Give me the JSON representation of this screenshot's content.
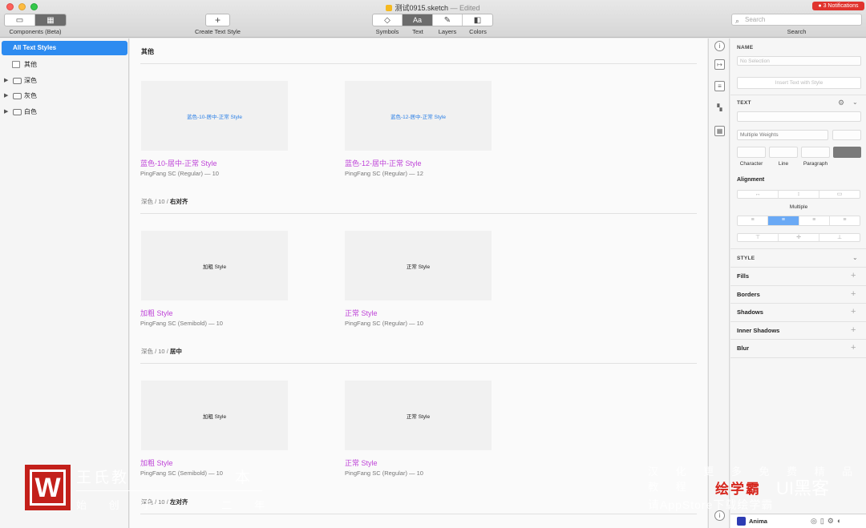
{
  "window": {
    "title": "测试0915.sketch",
    "status": "— Edited",
    "notifications": "● 3 Notifications"
  },
  "toolbar": {
    "components_label": "Components (Beta)",
    "create_label": "Create Text Style",
    "create_glyph": "+",
    "tabs": [
      {
        "label": "Symbols",
        "glyph": "◇"
      },
      {
        "label": "Text",
        "glyph": "Aa"
      },
      {
        "label": "Layers",
        "glyph": "✎"
      },
      {
        "label": "Colors",
        "glyph": "◧"
      }
    ],
    "active_tab": "Text",
    "search_placeholder": "Search",
    "search_label": "Search"
  },
  "sidebar": {
    "all": "All Text Styles",
    "items": [
      {
        "label": "其他",
        "expandable": false
      },
      {
        "label": "深色",
        "expandable": true
      },
      {
        "label": "灰色",
        "expandable": true
      },
      {
        "label": "白色",
        "expandable": true
      }
    ]
  },
  "sections": [
    {
      "title": "其他",
      "cards": [
        {
          "preview": "蓝色-10-居中-正常 Style",
          "name": "蓝色-10-居中-正常 Style",
          "meta": "PingFang SC (Regular) — 10"
        },
        {
          "preview": "蓝色-12-居中-正常 Style",
          "name": "蓝色-12-居中-正常 Style",
          "meta": "PingFang SC (Regular) — 12"
        }
      ]
    },
    {
      "crumb": [
        "深色",
        "10"
      ],
      "crumb_last": "右对齐",
      "cards": [
        {
          "preview": "加粗 Style",
          "name": "加粗 Style",
          "meta": "PingFang SC (Semibold) — 10"
        },
        {
          "preview": "正常 Style",
          "name": "正常 Style",
          "meta": "PingFang SC (Regular) — 10"
        }
      ]
    },
    {
      "crumb": [
        "深色",
        "10"
      ],
      "crumb_last": "居中",
      "cards": [
        {
          "preview": "加粗 Style",
          "name": "加粗 Style",
          "meta": "PingFang SC (Semibold) — 10"
        },
        {
          "preview": "正常 Style",
          "name": "正常 Style",
          "meta": "PingFang SC (Regular) — 10"
        }
      ]
    },
    {
      "crumb": [
        "深色",
        "10"
      ],
      "crumb_last": "左对齐"
    }
  ],
  "inspector": {
    "name_header": "NAME",
    "name_placeholder": "No Selection",
    "insert_button": "Insert Text with Style",
    "text_header": "TEXT",
    "weight_value": "Multiple Weights",
    "labels": [
      "Character",
      "Line",
      "Paragraph"
    ],
    "alignment_title": "Alignment",
    "alignment_value": "Multiple",
    "style_header": "STYLE",
    "rows": [
      "Fills",
      "Borders",
      "Shadows",
      "Inner Shadows",
      "Blur"
    ]
  },
  "anima": {
    "name": "Anima"
  },
  "watermark": {
    "left_title": "王氏教",
    "left_tail": "本",
    "left_sub": "始 创 于",
    "left_sub_tail": "二 年",
    "right_line1": "汉 化 更 多 免 费 精 品 教 程",
    "right_brand": "绘学霸",
    "right_big": "UI黑客",
    "right_line2": "请AppStore下载绘学霸"
  },
  "colors": {
    "accent": "#2d8bf0",
    "style_name": "#bf44d8",
    "blue_preview": "#2a7fe6",
    "notification": "#e0342e"
  }
}
